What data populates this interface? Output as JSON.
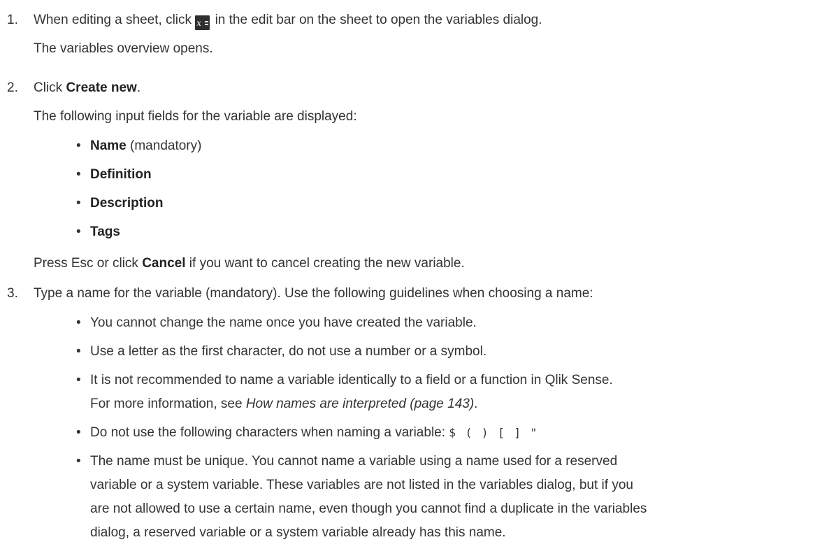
{
  "step1": {
    "number": "1.",
    "before_icon": "When editing a sheet, click",
    "icon": "variable-icon",
    "icon_glyph": "x",
    "after_icon": "in the edit bar on the sheet to open the variables dialog.",
    "sub": "The variables overview opens."
  },
  "step2": {
    "number": "2.",
    "prefix": "Click",
    "bold": "Create new",
    "suffix": ".",
    "sub": "The following input fields for the variable are displayed:",
    "fields": [
      {
        "bold": "Name",
        "rest": " (mandatory)"
      },
      {
        "bold": "Definition",
        "rest": ""
      },
      {
        "bold": "Description",
        "rest": ""
      },
      {
        "bold": "Tags",
        "rest": ""
      }
    ],
    "cancel_before": "Press Esc or click",
    "cancel_bold": "Cancel",
    "cancel_after": "if you want to cancel creating the new variable."
  },
  "step3": {
    "number": "3.",
    "text": "Type a name for the variable (mandatory). Use the following guidelines when choosing a name:",
    "bullets": [
      "You cannot change the name once you have created the variable.",
      "Use a letter as the first character, do not use a number or a symbol.",
      "It is not recommended to name a variable identically to a field or a function in Qlik Sense."
    ],
    "more_info_before": "For more information, see",
    "more_info_link": "How names are interpreted (page 143)",
    "more_info_after": ".",
    "chars_before": "Do not use the following characters when naming a variable:",
    "chars": "$ ( ) [ ] \"",
    "unique_lines": [
      "The name must be unique. You cannot name a variable using a name used for a reserved",
      "variable or a system variable. These variables are not listed in the variables dialog, but if you",
      "are not allowed to use a certain name, even though you cannot find a duplicate in the variables",
      "dialog, a reserved variable or a system variable already has this name."
    ]
  }
}
